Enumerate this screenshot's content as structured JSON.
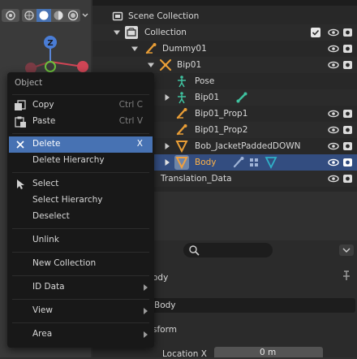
{
  "colors": {
    "viewport_bg": "#3a3a3a",
    "outliner_bg": "#282828",
    "menu_bg": "#181818",
    "highlight": "#4772b3",
    "selected_row": "#334d80",
    "armature_orange": "#e89d36",
    "bone_green": "#3fc19f",
    "mesh_cyan": "#2fb1c8"
  },
  "outliner": {
    "rows": [
      {
        "label": "Scene Collection",
        "icon": "scene-collection-icon"
      },
      {
        "label": "Collection",
        "icon": "collection-icon"
      },
      {
        "label": "Dummy01",
        "icon": "armature-icon"
      },
      {
        "label": "Bip01",
        "icon": "armature-icon"
      },
      {
        "label": "Pose",
        "icon": "pose-icon"
      },
      {
        "label": "Bip01",
        "icon": "armature-data-icon"
      },
      {
        "label": "Bip01_Prop1",
        "icon": "armature-icon"
      },
      {
        "label": "Bip01_Prop2",
        "icon": "armature-icon"
      },
      {
        "label": "Bob_JacketPaddedDOWN",
        "icon": "mesh-object-icon"
      },
      {
        "label": "Body",
        "icon": "mesh-object-icon"
      },
      {
        "label": "Translation_Data",
        "icon": ""
      }
    ]
  },
  "properties": {
    "object_name": "ody",
    "field_value": "Body",
    "section": "sform",
    "location_label": "Location X",
    "location_value": "0 m"
  },
  "menu": {
    "title": "Object",
    "items": {
      "copy": "Copy",
      "copy_sc": "Ctrl C",
      "paste": "Paste",
      "paste_sc": "Ctrl V",
      "delete": "Delete",
      "delete_sc": "X",
      "delete_hierarchy": "Delete Hierarchy",
      "select": "Select",
      "select_hierarchy": "Select Hierarchy",
      "deselect": "Deselect",
      "unlink": "Unlink",
      "new_collection": "New Collection",
      "id_data": "ID Data",
      "view": "View",
      "area": "Area"
    }
  }
}
